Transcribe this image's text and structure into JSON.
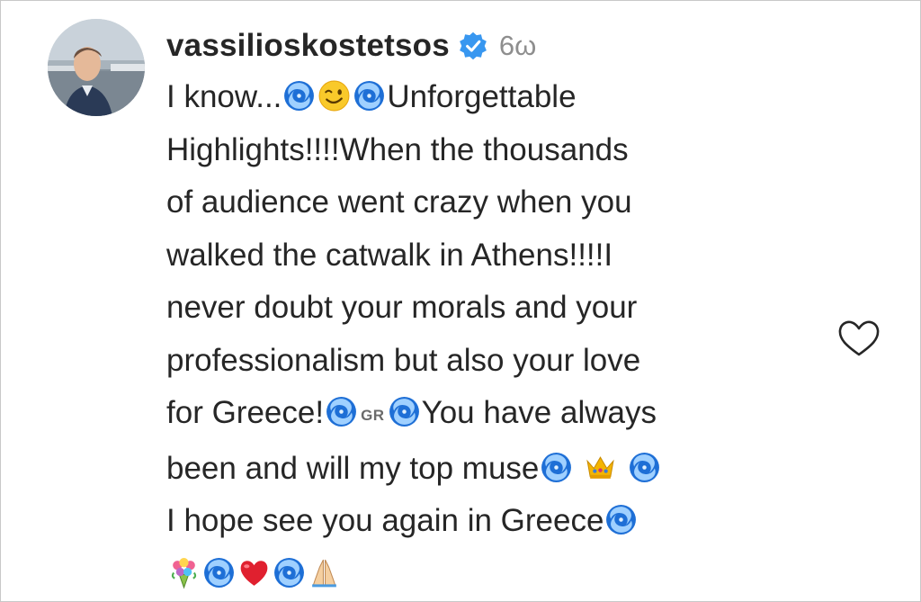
{
  "comment": {
    "username": "vassilioskostetsos",
    "verified": true,
    "timestamp": "6ω",
    "body": {
      "l1_a": "I know...",
      "l1_b": "Unforgettable",
      "l2": "Highlights!!!!When the thousands",
      "l3": "of audience went crazy when you",
      "l4": "walked the catwalk in Athens!!!!I",
      "l5": "never doubt your morals and your",
      "l6": "professionalism but also your love",
      "l7_a": "for Greece!",
      "l7_flag": "GR",
      "l7_b": "You have always",
      "l8": "been and will my top muse",
      "l9": "I hope see you again in Greece"
    },
    "icons": {
      "cyclone": "cyclone-emoji",
      "wink": "winking-face-emoji",
      "crown": "crown-emoji",
      "bouquet": "bouquet-emoji",
      "heart": "red-heart-emoji",
      "pray": "folded-hands-emoji",
      "like": "heart-outline-icon",
      "verified": "verified-badge-icon"
    },
    "colors": {
      "username": "#262626",
      "timestamp": "#8e8e8e",
      "verified": "#3897f0",
      "text": "#262626"
    }
  }
}
